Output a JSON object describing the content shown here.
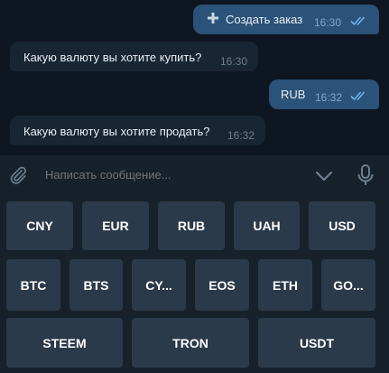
{
  "messages": [
    {
      "direction": "out",
      "text": "Создать заказ",
      "time": "16:30",
      "icon": "plus-icon",
      "read": true
    },
    {
      "direction": "in",
      "text": "Какую валюту вы хотите купить?",
      "time": "16:30"
    },
    {
      "direction": "out",
      "text": "RUB",
      "time": "16:32",
      "read": true
    },
    {
      "direction": "in",
      "text": "Какую валюту вы хотите продать?",
      "time": "16:32"
    }
  ],
  "composer": {
    "placeholder": "Написать сообщение...",
    "icons": [
      "paperclip-icon",
      "chevron-down-icon",
      "microphone-icon"
    ]
  },
  "keyboard": {
    "rows": [
      [
        "CNY",
        "EUR",
        "RUB",
        "UAH",
        "USD"
      ],
      [
        "BTC",
        "BTS",
        "CY...",
        "EOS",
        "ETH",
        "GO..."
      ],
      [
        "STEEM",
        "TRON",
        "USDT"
      ]
    ]
  },
  "colors": {
    "background": "#0e1621",
    "outgoing_bubble": "#2b5278",
    "incoming_bubble": "#182533",
    "panel": "#17212b",
    "key": "#2b3a4a",
    "read_ticks": "#6ab3f3"
  }
}
